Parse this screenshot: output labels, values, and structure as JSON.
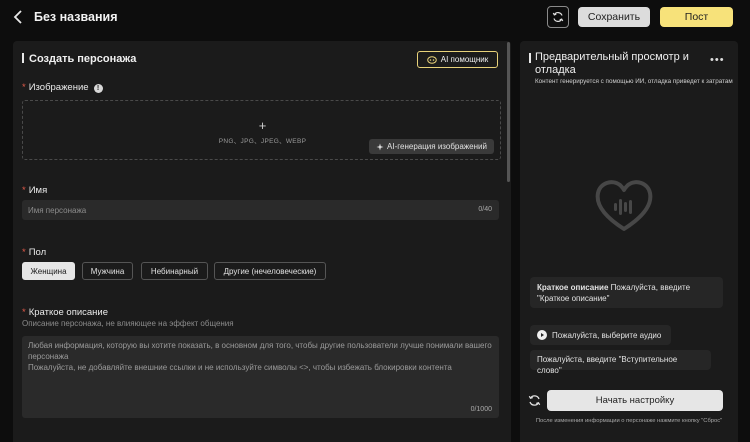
{
  "header": {
    "title": "Без названия",
    "save_label": "Сохранить",
    "post_label": "Пост"
  },
  "editor": {
    "section_title": "Создать персонажа",
    "ai_helper_label": "AI помощник",
    "image": {
      "label": "Изображение",
      "formats": "PNG、JPG、JPEG、WEBP",
      "ai_generate_label": "AI-генерация изображений"
    },
    "name": {
      "label": "Имя",
      "placeholder": "Имя персонажа",
      "counter": "0/40"
    },
    "gender": {
      "label": "Пол",
      "options": [
        "Женщина",
        "Мужчина",
        "Небинарный",
        "Другие (нечеловеческие)"
      ],
      "selected": "Женщина"
    },
    "description": {
      "label": "Краткое описание",
      "hint": "Описание персонажа, не влияющее на эффект общения",
      "placeholder": "Любая информация, которую вы хотите показать, в основном для того, чтобы другие пользователи лучше понимали вашего персонажа\nПожалуйста, не добавляйте внешние ссылки и не используйте символы <>, чтобы избежать блокировки контента",
      "counter": "0/1000"
    }
  },
  "preview": {
    "title": "Предварительный просмотр и отладка",
    "note": "Контент генерируется с помощью ИИ, отладка приведет к затратам",
    "summary_label": "Краткое описание",
    "summary_text": "Пожалуйста, введите \"Краткое описание\"",
    "audio_label": "Пожалуйста, выберите аудио",
    "intro_label": "Пожалуйста, введите \"Вступительное слово\"",
    "start_label": "Начать настройку",
    "footnote": "После изменения информации о персонаже нажмите кнопку \"Сброс\""
  },
  "colors": {
    "accent": "#f7e27a",
    "panel": "#1b1b1b",
    "background": "#0d0d0d",
    "required": "#e25b4a"
  },
  "icons": [
    "back-icon",
    "refresh-icon",
    "ai-helper-icon",
    "help-icon",
    "plus-icon",
    "sparkle-icon",
    "heart-voice-icon",
    "more-icon",
    "play-icon",
    "reset-icon"
  ]
}
